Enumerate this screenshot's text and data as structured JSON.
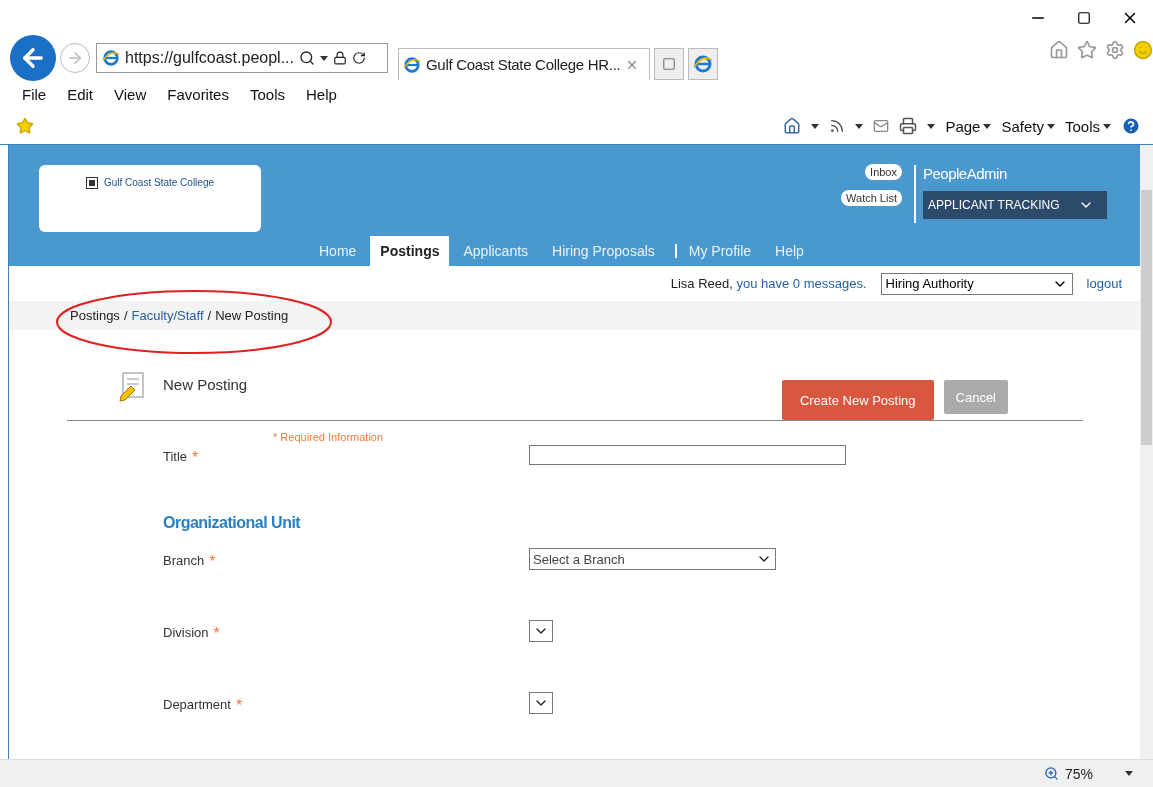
{
  "browser": {
    "url": "https://gulfcoast.peopl...",
    "tab_title": "Gulf Coast State College HR...",
    "menu": [
      "File",
      "Edit",
      "View",
      "Favorites",
      "Tools",
      "Help"
    ],
    "commands": [
      "Page",
      "Safety",
      "Tools"
    ],
    "zoom": "75%"
  },
  "header": {
    "logo_text": "Gulf Coast State College",
    "inbox": "Inbox",
    "watch_list": "Watch List",
    "brand": "PeopleAdmin",
    "module": "APPLICANT TRACKING",
    "nav": [
      {
        "label": "Home",
        "selected": false
      },
      {
        "label": "Postings",
        "selected": true
      },
      {
        "label": "Applicants",
        "selected": false
      },
      {
        "label": "Hiring Proposals",
        "selected": false
      },
      {
        "label": "My Profile",
        "selected": false
      },
      {
        "label": "Help",
        "selected": false
      }
    ]
  },
  "user_bar": {
    "name": "Lisa Reed,",
    "messages": "you have 0 messages.",
    "role": "Hiring Authority",
    "logout": "logout"
  },
  "breadcrumb": [
    {
      "label": "Postings",
      "kind": "text"
    },
    {
      "label": "/",
      "kind": "sep"
    },
    {
      "label": "Faculty/Staff",
      "kind": "link"
    },
    {
      "label": "/",
      "kind": "sep"
    },
    {
      "label": "New Posting",
      "kind": "text"
    }
  ],
  "form": {
    "title": "New Posting",
    "buttons": [
      {
        "label": "Create New Posting",
        "kind": "primary"
      },
      {
        "label": "Cancel",
        "kind": "secondary"
      }
    ],
    "required_note": "* Required Information",
    "fields": [
      {
        "kind": "text",
        "label": "Title",
        "required_mark": "*"
      },
      {
        "kind": "heading",
        "label": "Organizational Unit"
      },
      {
        "kind": "select",
        "label": "Branch",
        "required_mark": "*",
        "value": "Select a Branch"
      },
      {
        "kind": "select",
        "label": "Division",
        "required_mark": "*"
      },
      {
        "kind": "select",
        "label": "Department",
        "required_mark": "*"
      }
    ]
  }
}
